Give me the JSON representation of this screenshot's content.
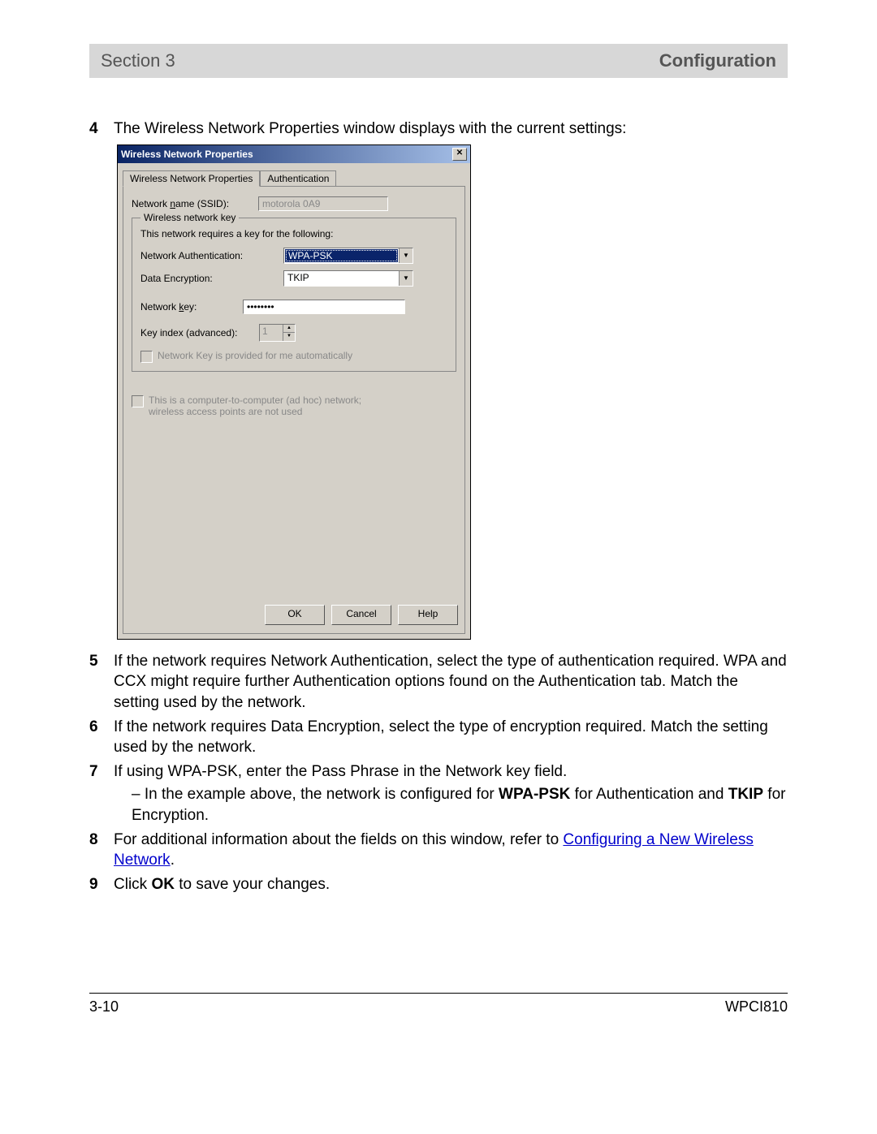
{
  "header": {
    "left": "Section 3",
    "right": "Configuration"
  },
  "steps": {
    "s4": {
      "num": "4",
      "text": "The Wireless Network Properties window displays with the current settings:"
    },
    "s5": {
      "num": "5",
      "text": "If the network requires Network Authentication, select the type of authentication required. WPA and CCX might require further Authentication options found on the Authentication tab. Match the setting used by the network."
    },
    "s6": {
      "num": "6",
      "text": "If the network requires Data Encryption, select the type of encryption required. Match the setting used by the network."
    },
    "s7": {
      "num": "7",
      "text": "If using WPA-PSK, enter the Pass Phrase in the Network key field.",
      "sub_pre": "–  In the example above, the network is configured for ",
      "bold1": "WPA-PSK",
      "mid": " for Authentication and ",
      "bold2": "TKIP",
      "post": " for Encryption."
    },
    "s8": {
      "num": "8",
      "pre": "For additional information about the fields on this window, refer to ",
      "link": "Configuring a New Wireless Network",
      "post": "."
    },
    "s9": {
      "num": "9",
      "pre": "Click ",
      "bold": "OK",
      "post": " to save your changes."
    }
  },
  "dialog": {
    "title": "Wireless Network Properties",
    "tabs": {
      "t1": "Wireless Network Properties",
      "t2": "Authentication"
    },
    "ssid_label_pre": "Network ",
    "ssid_label_u": "n",
    "ssid_label_post": "ame (SSID):",
    "ssid_value": "motorola 0A9",
    "groupbox": "Wireless network key",
    "group_text": "This network requires a key for the following:",
    "auth_label": "Network Authentication:",
    "auth_value": "WPA-PSK",
    "enc_label": "Data Encryption:",
    "enc_value": "TKIP",
    "key_label_pre": "Network ",
    "key_label_u": "k",
    "key_label_post": "ey:",
    "key_value": "••••••••",
    "index_label": "Key index (advanced):",
    "index_value": "1",
    "chk1": "Network Key is provided for me automatically",
    "chk2a": "This is a computer-to-computer (ad hoc) network;",
    "chk2b": "wireless access points are not used",
    "ok": "OK",
    "cancel": "Cancel",
    "help": "Help"
  },
  "footer": {
    "left": "3-10",
    "right": "WPCI810"
  }
}
